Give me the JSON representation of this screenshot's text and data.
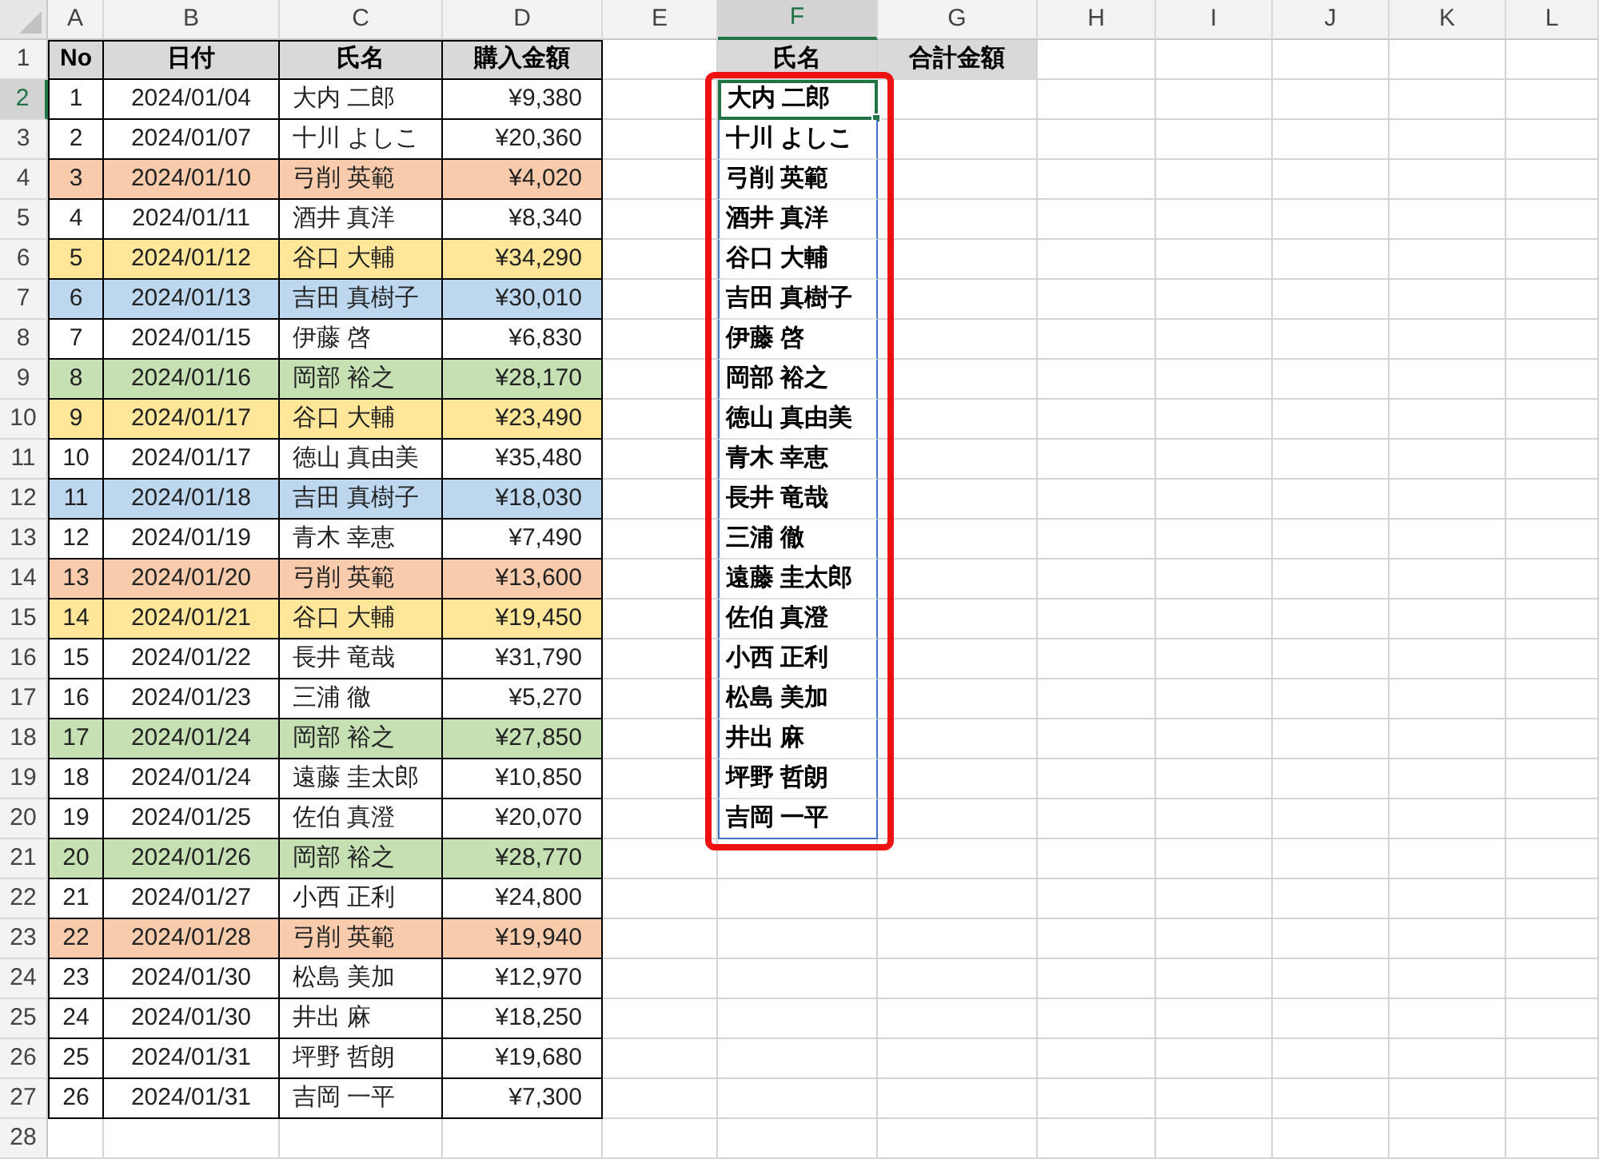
{
  "column_headers": [
    {
      "label": "A",
      "selected": false
    },
    {
      "label": "B",
      "selected": false
    },
    {
      "label": "C",
      "selected": false
    },
    {
      "label": "D",
      "selected": false
    },
    {
      "label": "E",
      "selected": false
    },
    {
      "label": "F",
      "selected": true
    },
    {
      "label": "G",
      "selected": false
    },
    {
      "label": "H",
      "selected": false
    },
    {
      "label": "I",
      "selected": false
    },
    {
      "label": "J",
      "selected": false
    },
    {
      "label": "K",
      "selected": false
    },
    {
      "label": "L",
      "selected": false
    }
  ],
  "row_headers": [
    {
      "label": "1",
      "selected": false
    },
    {
      "label": "2",
      "selected": true
    },
    {
      "label": "3",
      "selected": false
    },
    {
      "label": "4",
      "selected": false
    },
    {
      "label": "5",
      "selected": false
    },
    {
      "label": "6",
      "selected": false
    },
    {
      "label": "7",
      "selected": false
    },
    {
      "label": "8",
      "selected": false
    },
    {
      "label": "9",
      "selected": false
    },
    {
      "label": "10",
      "selected": false
    },
    {
      "label": "11",
      "selected": false
    },
    {
      "label": "12",
      "selected": false
    },
    {
      "label": "13",
      "selected": false
    },
    {
      "label": "14",
      "selected": false
    },
    {
      "label": "15",
      "selected": false
    },
    {
      "label": "16",
      "selected": false
    },
    {
      "label": "17",
      "selected": false
    },
    {
      "label": "18",
      "selected": false
    },
    {
      "label": "19",
      "selected": false
    },
    {
      "label": "20",
      "selected": false
    },
    {
      "label": "21",
      "selected": false
    },
    {
      "label": "22",
      "selected": false
    },
    {
      "label": "23",
      "selected": false
    },
    {
      "label": "24",
      "selected": false
    },
    {
      "label": "25",
      "selected": false
    },
    {
      "label": "26",
      "selected": false
    },
    {
      "label": "27",
      "selected": false
    },
    {
      "label": "28",
      "selected": false
    }
  ],
  "table": {
    "columns": [
      "No",
      "日付",
      "氏名",
      "購入金額"
    ],
    "rows": [
      {
        "cells": [
          "1",
          "2024/01/04",
          "大内 二郎",
          "¥9,380"
        ],
        "color": "#ffffff"
      },
      {
        "cells": [
          "2",
          "2024/01/07",
          "十川 よしこ",
          "¥20,360"
        ],
        "color": "#ffffff"
      },
      {
        "cells": [
          "3",
          "2024/01/10",
          "弓削 英範",
          "¥4,020"
        ],
        "color": "#f8cbad"
      },
      {
        "cells": [
          "4",
          "2024/01/11",
          "酒井 真洋",
          "¥8,340"
        ],
        "color": "#ffffff"
      },
      {
        "cells": [
          "5",
          "2024/01/12",
          "谷口 大輔",
          "¥34,290"
        ],
        "color": "#ffe699"
      },
      {
        "cells": [
          "6",
          "2024/01/13",
          "吉田 真樹子",
          "¥30,010"
        ],
        "color": "#bdd7ee"
      },
      {
        "cells": [
          "7",
          "2024/01/15",
          "伊藤 啓",
          "¥6,830"
        ],
        "color": "#ffffff"
      },
      {
        "cells": [
          "8",
          "2024/01/16",
          "岡部 裕之",
          "¥28,170"
        ],
        "color": "#c6e0b4"
      },
      {
        "cells": [
          "9",
          "2024/01/17",
          "谷口 大輔",
          "¥23,490"
        ],
        "color": "#ffe699"
      },
      {
        "cells": [
          "10",
          "2024/01/17",
          "徳山 真由美",
          "¥35,480"
        ],
        "color": "#ffffff"
      },
      {
        "cells": [
          "11",
          "2024/01/18",
          "吉田 真樹子",
          "¥18,030"
        ],
        "color": "#bdd7ee"
      },
      {
        "cells": [
          "12",
          "2024/01/19",
          "青木 幸恵",
          "¥7,490"
        ],
        "color": "#ffffff"
      },
      {
        "cells": [
          "13",
          "2024/01/20",
          "弓削 英範",
          "¥13,600"
        ],
        "color": "#f8cbad"
      },
      {
        "cells": [
          "14",
          "2024/01/21",
          "谷口 大輔",
          "¥19,450"
        ],
        "color": "#ffe699"
      },
      {
        "cells": [
          "15",
          "2024/01/22",
          "長井 竜哉",
          "¥31,790"
        ],
        "color": "#ffffff"
      },
      {
        "cells": [
          "16",
          "2024/01/23",
          "三浦 徹",
          "¥5,270"
        ],
        "color": "#ffffff"
      },
      {
        "cells": [
          "17",
          "2024/01/24",
          "岡部 裕之",
          "¥27,850"
        ],
        "color": "#c6e0b4"
      },
      {
        "cells": [
          "18",
          "2024/01/24",
          "遠藤 圭太郎",
          "¥10,850"
        ],
        "color": "#ffffff"
      },
      {
        "cells": [
          "19",
          "2024/01/25",
          "佐伯 真澄",
          "¥20,070"
        ],
        "color": "#ffffff"
      },
      {
        "cells": [
          "20",
          "2024/01/26",
          "岡部 裕之",
          "¥28,770"
        ],
        "color": "#c6e0b4"
      },
      {
        "cells": [
          "21",
          "2024/01/27",
          "小西 正利",
          "¥24,800"
        ],
        "color": "#ffffff"
      },
      {
        "cells": [
          "22",
          "2024/01/28",
          "弓削 英範",
          "¥19,940"
        ],
        "color": "#f8cbad"
      },
      {
        "cells": [
          "23",
          "2024/01/30",
          "松島 美加",
          "¥12,970"
        ],
        "color": "#ffffff"
      },
      {
        "cells": [
          "24",
          "2024/01/30",
          "井出 麻",
          "¥18,250"
        ],
        "color": "#ffffff"
      },
      {
        "cells": [
          "25",
          "2024/01/31",
          "坪野 哲朗",
          "¥19,680"
        ],
        "color": "#ffffff"
      },
      {
        "cells": [
          "26",
          "2024/01/31",
          "吉岡 一平",
          "¥7,300"
        ],
        "color": "#ffffff"
      }
    ]
  },
  "name_list": {
    "columns": [
      "氏名",
      "合計金額"
    ],
    "highlighted": true,
    "names": [
      {
        "text": "大内 二郎",
        "selected": true
      },
      {
        "text": "十川 よしこ",
        "selected": false
      },
      {
        "text": "弓削 英範",
        "selected": false
      },
      {
        "text": "酒井 真洋",
        "selected": false
      },
      {
        "text": "谷口 大輔",
        "selected": false
      },
      {
        "text": "吉田 真樹子",
        "selected": false
      },
      {
        "text": "伊藤 啓",
        "selected": false
      },
      {
        "text": "岡部 裕之",
        "selected": false
      },
      {
        "text": "徳山 真由美",
        "selected": false
      },
      {
        "text": "青木 幸恵",
        "selected": false
      },
      {
        "text": "長井 竜哉",
        "selected": false
      },
      {
        "text": "三浦 徹",
        "selected": false
      },
      {
        "text": "遠藤 圭太郎",
        "selected": false
      },
      {
        "text": "佐伯 真澄",
        "selected": false
      },
      {
        "text": "小西 正利",
        "selected": false
      },
      {
        "text": "松島 美加",
        "selected": false
      },
      {
        "text": "井出 麻",
        "selected": false
      },
      {
        "text": "坪野 哲朗",
        "selected": false
      },
      {
        "text": "吉岡 一平",
        "selected": false
      }
    ]
  }
}
